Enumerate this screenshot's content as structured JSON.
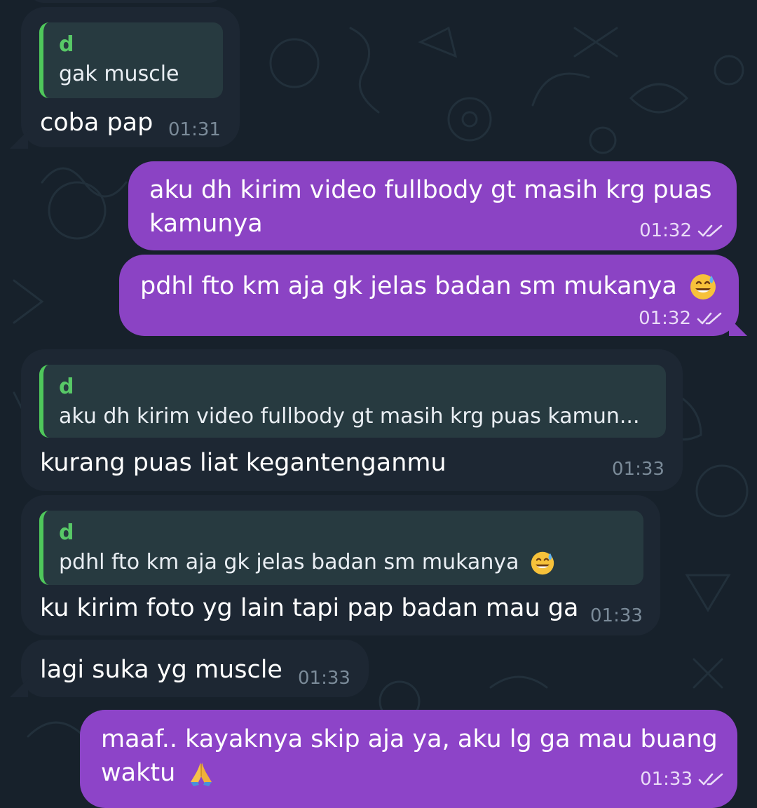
{
  "messages": [
    {
      "direction": "incoming",
      "reply": {
        "name": "d",
        "text": "gak muscle"
      },
      "text": "coba pap",
      "time": "01:31"
    },
    {
      "direction": "outgoing",
      "text_line1": "aku dh kirim video fullbody gt masih krg puas",
      "text_line2": "kamunya",
      "time": "01:32",
      "status": "read"
    },
    {
      "direction": "outgoing",
      "text": "pdhl fto km aja gk jelas badan sm mukanya",
      "emoji": "grinning-face-with-sweat-emoji",
      "time": "01:32",
      "status": "read"
    },
    {
      "direction": "incoming",
      "reply": {
        "name": "d",
        "text": "aku dh kirim video fullbody gt masih krg puas kamun..."
      },
      "text": "kurang puas liat kegantenganmu",
      "time": "01:33"
    },
    {
      "direction": "incoming",
      "reply": {
        "name": "d",
        "text": "pdhl fto km aja gk jelas badan sm mukanya",
        "emoji": "grinning-face-with-sweat-emoji"
      },
      "text": "ku kirim foto yg lain tapi pap badan mau ga",
      "time": "01:33"
    },
    {
      "direction": "incoming",
      "text": "lagi suka yg muscle",
      "time": "01:33"
    },
    {
      "direction": "outgoing",
      "text_line1": "maaf.. kayaknya skip aja ya, aku lg ga mau buang",
      "text_line2": "waktu",
      "emoji": "folded-hands-emoji",
      "time": "01:33",
      "status": "read"
    }
  ],
  "colors": {
    "background": "#17212b",
    "incoming_bubble": "#1d2733",
    "outgoing_bubble": "#8b43c4",
    "reply_accent": "#4fc75b"
  }
}
